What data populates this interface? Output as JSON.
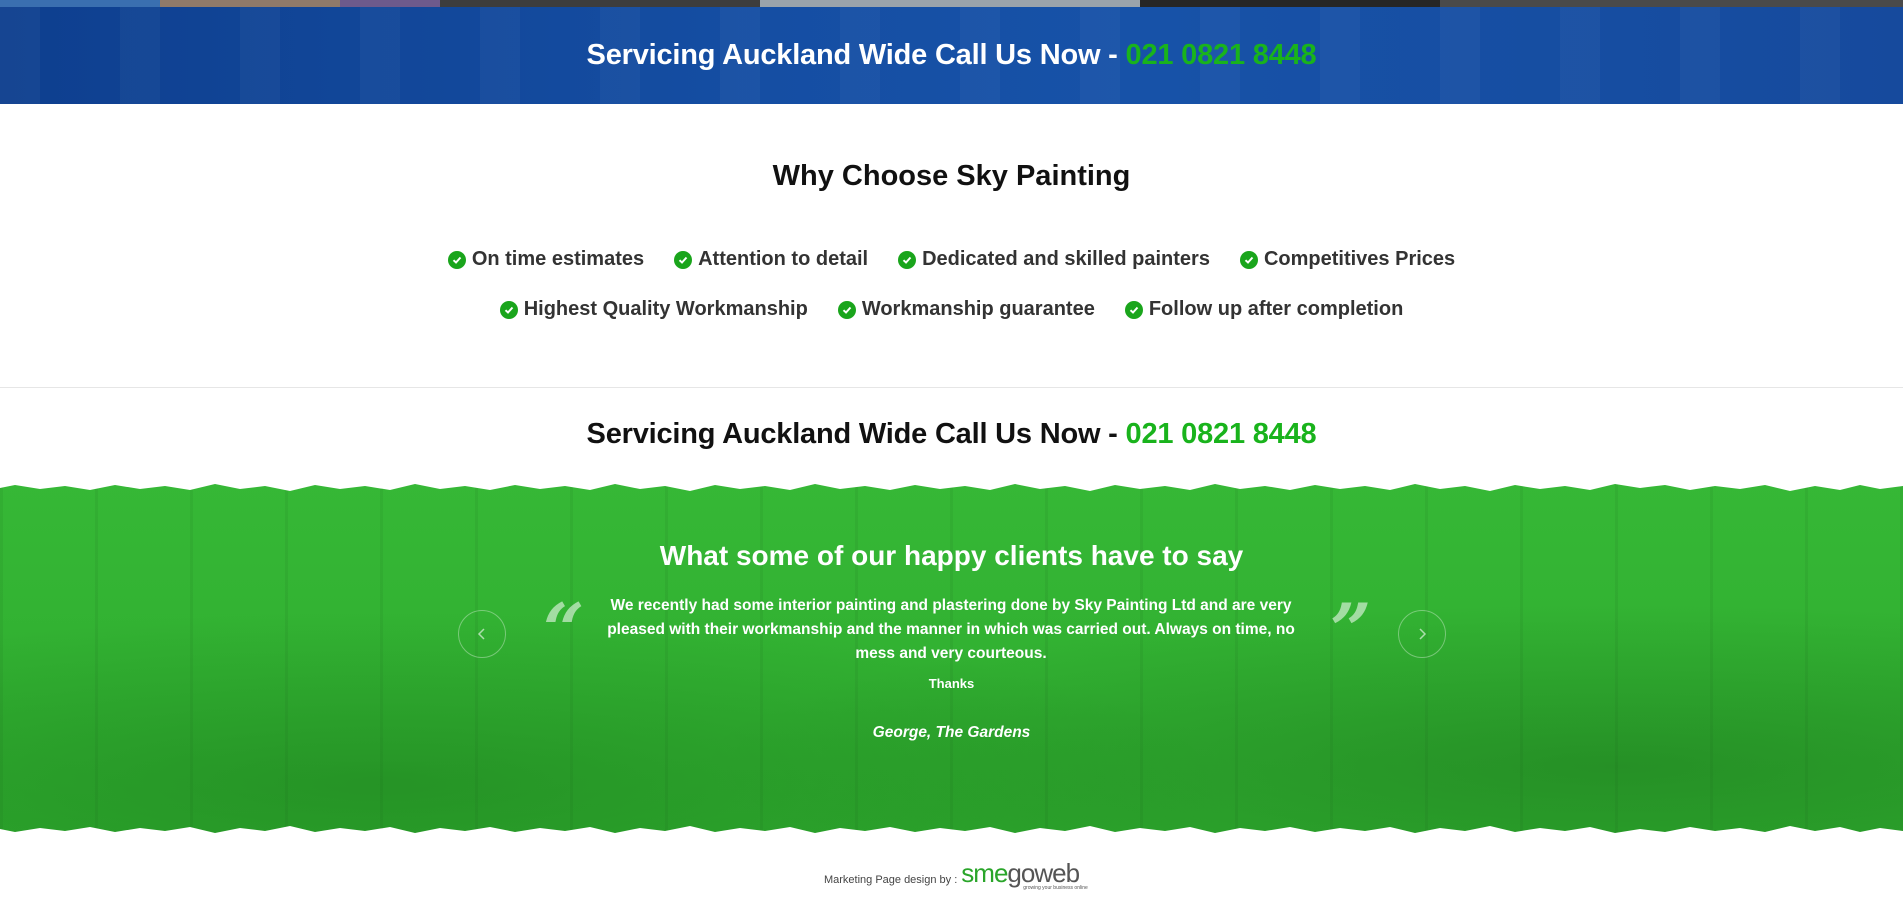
{
  "top_banner": {
    "call_text": "Servicing Auckland Wide Call Us Now - ",
    "phone": "021 0821 8448"
  },
  "why_choose": {
    "title": "Why Choose Sky Painting",
    "features_row1": [
      "On time estimates",
      "Attention to detail",
      "Dedicated and skilled painters",
      "Competitives Prices"
    ],
    "features_row2": [
      "Highest Quality Workmanship",
      "Workmanship guarantee",
      "Follow up after completion"
    ]
  },
  "call_section": {
    "call_text": "Servicing Auckland Wide Call Us Now - ",
    "phone": "021 0821 8448"
  },
  "testimonial": {
    "title": "What some of our happy clients have to say",
    "quote": "We recently had some interior painting and plastering done by Sky Painting Ltd and are very pleased with their workmanship and the manner in which was carried out. Always on time, no mess and very courteous.",
    "thanks": "Thanks",
    "author": "George, The Gardens",
    "open_quote": "“",
    "close_quote": "”",
    "prev_icon": "chevron-left-icon",
    "next_icon": "chevron-right-icon"
  },
  "footer": {
    "label": "Marketing Page design by :",
    "logo_sme": "sme",
    "logo_goweb": "goweb",
    "logo_tagline": "growing your business online"
  },
  "colors": {
    "banner_blue": "#154ea3",
    "phone_green": "#19b31c",
    "testimonial_green": "#33b533",
    "check_green": "#1aa51c"
  }
}
